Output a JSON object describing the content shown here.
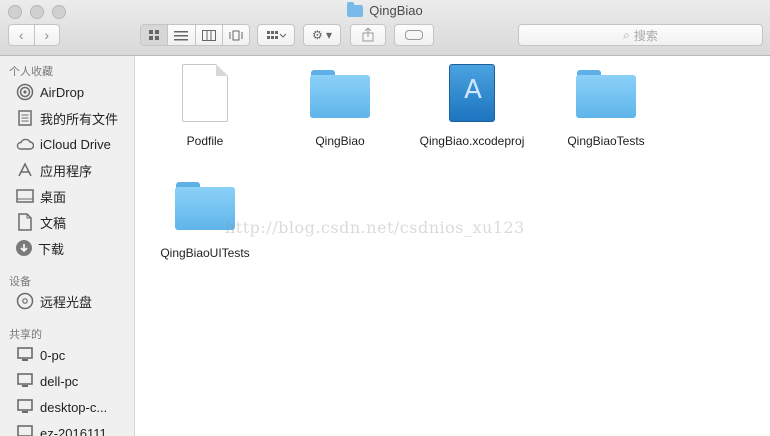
{
  "window": {
    "title": "QingBiao"
  },
  "toolbar": {
    "back": "‹",
    "forward": "›",
    "search_placeholder": "搜索"
  },
  "sidebar": {
    "sections": [
      {
        "heading": "个人收藏",
        "items": [
          "AirDrop",
          "我的所有文件",
          "iCloud Drive",
          "应用程序",
          "桌面",
          "文稿",
          "下载"
        ]
      },
      {
        "heading": "设备",
        "items": [
          "远程光盘"
        ]
      },
      {
        "heading": "共享的",
        "items": [
          "0-pc",
          "dell-pc",
          "desktop-c...",
          "ez-2016111..."
        ]
      }
    ]
  },
  "files": [
    {
      "name": "Podfile",
      "kind": "document"
    },
    {
      "name": "QingBiao",
      "kind": "folder"
    },
    {
      "name": "QingBiao.xcodeproj",
      "kind": "xcodeproj"
    },
    {
      "name": "QingBiaoTests",
      "kind": "folder"
    },
    {
      "name": "QingBiaoUITests",
      "kind": "folder"
    }
  ],
  "watermark": "http://blog.csdn.net/csdnios_xu123"
}
